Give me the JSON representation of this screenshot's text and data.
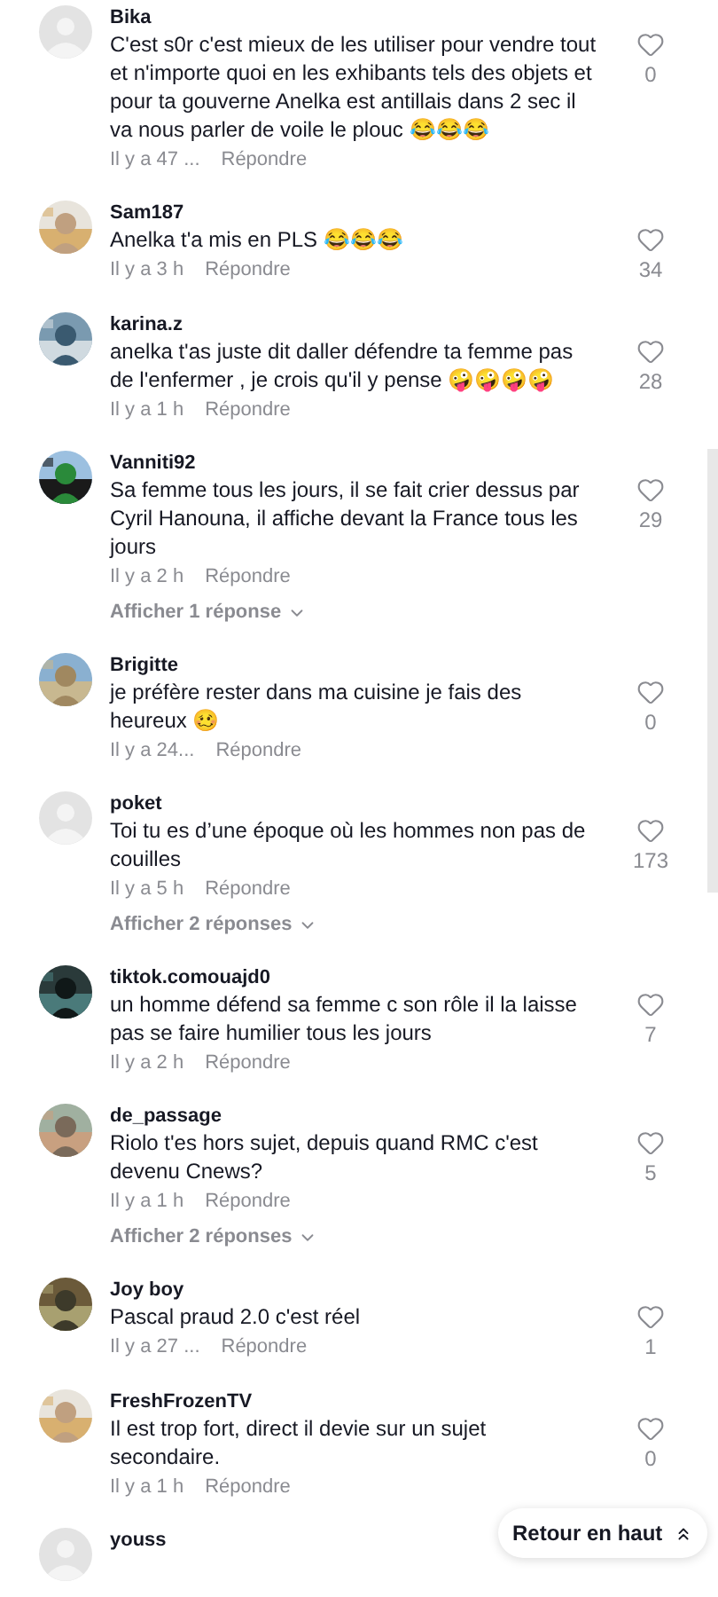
{
  "comments": [
    {
      "user": "Bika",
      "avatar": {
        "kind": "default"
      },
      "text": "C'est s0r c'est mieux de les utiliser pour vendre tout et n'importe quoi en les exhibants tels des objets et pour ta gouverne Anelka est antillais dans 2 sec il va nous parler de voile le plouc 😂😂😂",
      "time": "Il y a 47 ...",
      "reply": "Répondre",
      "likes": "0"
    },
    {
      "user": "Sam187",
      "text": "Anelka t'a mis en PLS 😂😂😂",
      "time": "Il y a 3 h",
      "reply": "Répondre",
      "likes": "34"
    },
    {
      "user": "karina.z",
      "text": "anelka t'as juste dit daller défendre ta femme pas de l'enfermer , je crois qu'il y pense 🤪🤪🤪🤪",
      "time": "Il y a 1 h",
      "reply": "Répondre",
      "likes": "28"
    },
    {
      "user": "Vanniti92",
      "text": "Sa femme tous les jours, il se fait crier dessus par Cyril Hanouna, il affiche devant la France tous les jours",
      "time": "Il y a 2 h",
      "reply": "Répondre",
      "likes": "29",
      "replies": "Afficher 1 réponse"
    },
    {
      "user": "Brigitte",
      "text": "je préfère rester dans ma cuisine je fais des heureux 🥴",
      "time": "Il y a 24...",
      "reply": "Répondre",
      "likes": "0"
    },
    {
      "user": "poket",
      "avatar": {
        "kind": "default"
      },
      "text": "Toi tu es d’une époque où les hommes non pas de couilles",
      "time": "Il y a 5 h",
      "reply": "Répondre",
      "likes": "173",
      "replies": "Afficher 2 réponses"
    },
    {
      "user": "tiktok.comouajd0",
      "text": "un homme défend sa femme c son rôle il la laisse pas se faire humilier tous les jours",
      "time": "Il y a 2 h",
      "reply": "Répondre",
      "likes": "7"
    },
    {
      "user": "de_passage",
      "text": "Riolo t'es hors sujet, depuis quand RMC c'est devenu Cnews?",
      "time": "Il y a 1 h",
      "reply": "Répondre",
      "likes": "5",
      "replies": "Afficher 2 réponses"
    },
    {
      "user": "Joy boy",
      "text": "Pascal praud 2.0 c'est réel",
      "time": "Il y a 27 ...",
      "reply": "Répondre",
      "likes": "1"
    },
    {
      "user": "FreshFrozenTV",
      "text": "Il est trop fort, direct il devie sur un sujet secondaire.",
      "time": "Il y a 1 h",
      "reply": "Répondre",
      "likes": "0"
    },
    {
      "user": "youss",
      "avatar": {
        "kind": "default"
      }
    }
  ],
  "back_to_top": "Retour en haut"
}
